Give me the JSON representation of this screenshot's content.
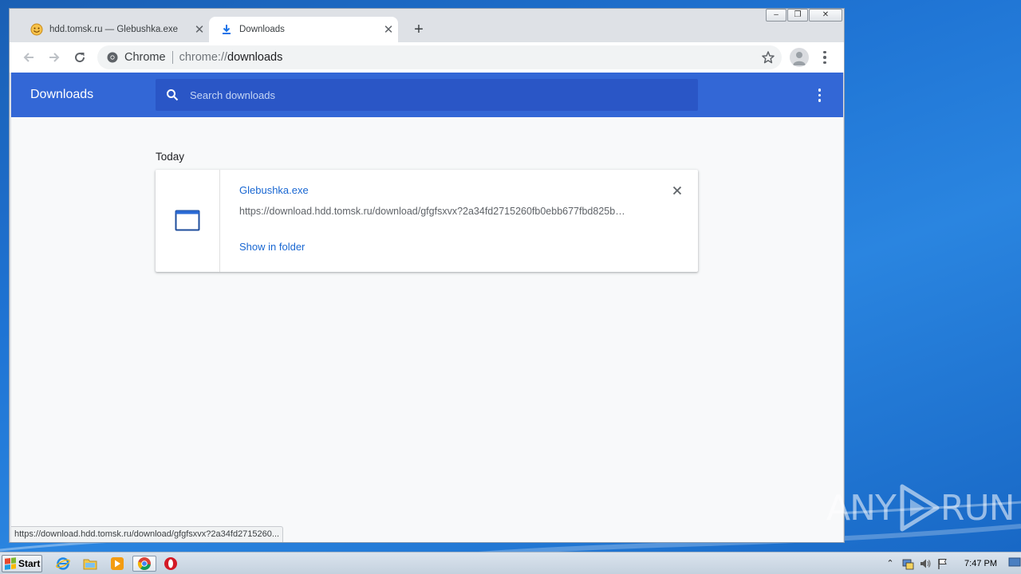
{
  "browser": {
    "tabs": [
      {
        "title": "hdd.tomsk.ru — Glebushka.exe",
        "icon": "smiley-favicon-icon",
        "active": false
      },
      {
        "title": "Downloads",
        "icon": "download-icon",
        "active": true
      }
    ],
    "window_controls": {
      "minimize": "–",
      "restore": "❐",
      "close": "✕"
    },
    "omnibox": {
      "chip": "Chrome",
      "scheme": "chrome://",
      "path": "downloads"
    }
  },
  "downloads_page": {
    "title": "Downloads",
    "search_placeholder": "Search downloads",
    "section_label": "Today",
    "items": [
      {
        "file_name": "Glebushka.exe",
        "url": "https://download.hdd.tomsk.ru/download/gfgfsxvx?2a34fd2715260fb0ebb677fbd825b…",
        "action": "Show in folder",
        "icon": "window-file-icon"
      }
    ]
  },
  "status_bar": {
    "url": "https://download.hdd.tomsk.ru/download/gfgfsxvx?2a34fd2715260..."
  },
  "taskbar": {
    "start_label": "Start",
    "clock": "7:47 PM",
    "pinned": [
      "ie-icon",
      "explorer-icon",
      "media-player-icon",
      "chrome-icon",
      "opera-icon"
    ]
  },
  "watermark": {
    "text_left": "ANY",
    "text_right": "RUN"
  },
  "colors": {
    "header_blue": "#3367d6",
    "search_blue": "#2a56c6",
    "link_blue": "#1967d2"
  }
}
